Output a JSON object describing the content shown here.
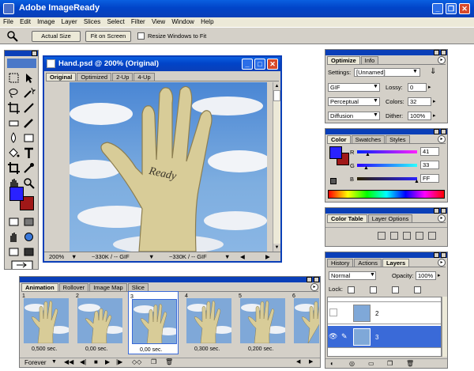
{
  "app": {
    "title": "Adobe ImageReady",
    "menus": [
      "File",
      "Edit",
      "Image",
      "Layer",
      "Slices",
      "Select",
      "Filter",
      "View",
      "Window",
      "Help"
    ]
  },
  "options_bar": {
    "actual_size": "Actual Size",
    "fit_on_screen": "Fit on Screen",
    "resize_windows": "Resize Windows to Fit"
  },
  "document": {
    "title": "Hand.psd @ 200% (Original)",
    "tabs": [
      "Original",
      "Optimized",
      "2-Up",
      "4-Up"
    ],
    "zoom": "200%",
    "size1": "~330K / -- GIF",
    "size2": "~330K / -- GIF",
    "image_text": "Ready"
  },
  "optimize": {
    "tabs": [
      "Optimize",
      "Info"
    ],
    "settings_label": "Settings:",
    "settings_value": "[Unnamed]",
    "format": "GIF",
    "lossy_label": "Lossy:",
    "lossy_value": "0",
    "palette": "Perceptual",
    "colors_label": "Colors:",
    "colors_value": "32",
    "dither_mode": "Diffusion",
    "dither_label": "Dither:",
    "dither_value": "100%"
  },
  "color": {
    "tabs": [
      "Color",
      "Swatches",
      "Styles"
    ],
    "r_label": "R",
    "g_label": "G",
    "b_label": "B",
    "r_value": "41",
    "g_value": "33",
    "b_value": "FF",
    "foreground": "#2921ff",
    "background": "#a01818"
  },
  "color_table": {
    "tabs": [
      "Color Table",
      "Layer Options"
    ]
  },
  "layers": {
    "tabs": [
      "History",
      "Actions",
      "Layers"
    ],
    "blend_mode": "Normal",
    "opacity_label": "Opacity:",
    "opacity_value": "100%",
    "lock_label": "Lock:",
    "rows": [
      {
        "name": "2"
      },
      {
        "name": "3"
      }
    ]
  },
  "animation": {
    "tabs": [
      "Animation",
      "Rollover",
      "Image Map",
      "Slice"
    ],
    "loop": "Forever",
    "frames": [
      {
        "num": "1",
        "time": "0,500 sec."
      },
      {
        "num": "2",
        "time": "0,00 sec."
      },
      {
        "num": "3",
        "time": "0,00 sec."
      },
      {
        "num": "4",
        "time": "0,300 sec."
      },
      {
        "num": "5",
        "time": "0,200 sec."
      },
      {
        "num": "6",
        "time": ""
      }
    ]
  }
}
